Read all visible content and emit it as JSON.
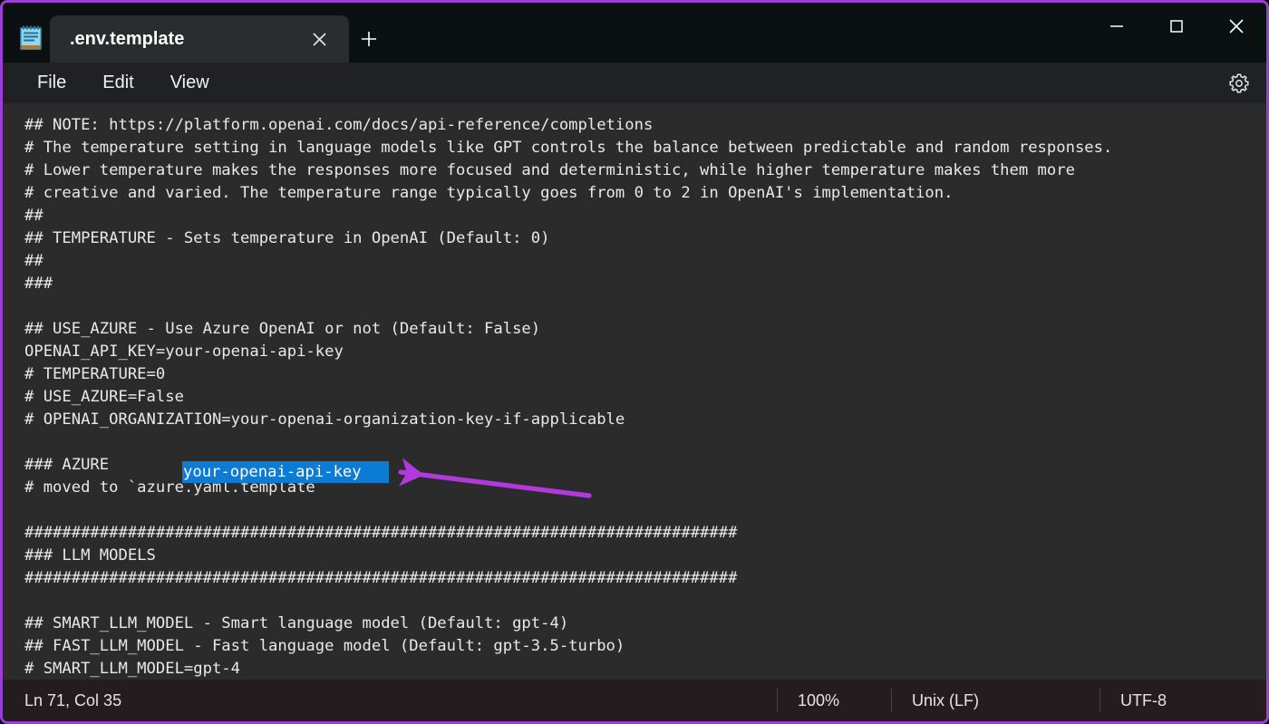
{
  "window": {
    "border_color": "#9b3fd4",
    "titlebar_bg": "#0a1110",
    "editor_bg": "#2b2b2b",
    "statusbar_bg": "#241c1f"
  },
  "titlebar": {
    "app_icon": "notepad-icon",
    "tabs": [
      {
        "title": ".env.template",
        "active": true,
        "close_glyph": "✕"
      }
    ],
    "new_tab_glyph": "+",
    "controls": {
      "minimize_glyph": "—",
      "maximize_glyph": "□",
      "close_glyph": "✕"
    }
  },
  "menubar": {
    "items": [
      {
        "label": "File"
      },
      {
        "label": "Edit"
      },
      {
        "label": "View"
      }
    ],
    "settings_icon": "gear-icon"
  },
  "editor": {
    "content": "## NOTE: https://platform.openai.com/docs/api-reference/completions\n# The temperature setting in language models like GPT controls the balance between predictable and random responses.\n# Lower temperature makes the responses more focused and deterministic, while higher temperature makes them more\n# creative and varied. The temperature range typically goes from 0 to 2 in OpenAI's implementation.\n##\n## TEMPERATURE - Sets temperature in OpenAI (Default: 0)\n##\n###\n\n## USE_AZURE - Use Azure OpenAI or not (Default: False)\nOPENAI_API_KEY=your-openai-api-key\n# TEMPERATURE=0\n# USE_AZURE=False\n# OPENAI_ORGANIZATION=your-openai-organization-key-if-applicable\n\n### AZURE\n# moved to `azure.yaml.template`\n\n############################################################################\n### LLM MODELS\n############################################################################\n\n## SMART_LLM_MODEL - Smart language model (Default: gpt-4)\n## FAST_LLM_MODEL - Fast language model (Default: gpt-3.5-turbo)\n# SMART_LLM_MODEL=gpt-4",
    "selection": {
      "text": "your-openai-api-key",
      "highlight_color": "#0b7bd4",
      "text_color": "#ffffff"
    },
    "annotation": {
      "type": "arrow",
      "color": "#b03ae0",
      "direction": "left",
      "points_to": "your-openai-api-key"
    }
  },
  "statusbar": {
    "position": "Ln 71, Col 35",
    "zoom": "100%",
    "line_ending": "Unix (LF)",
    "encoding": "UTF-8"
  }
}
